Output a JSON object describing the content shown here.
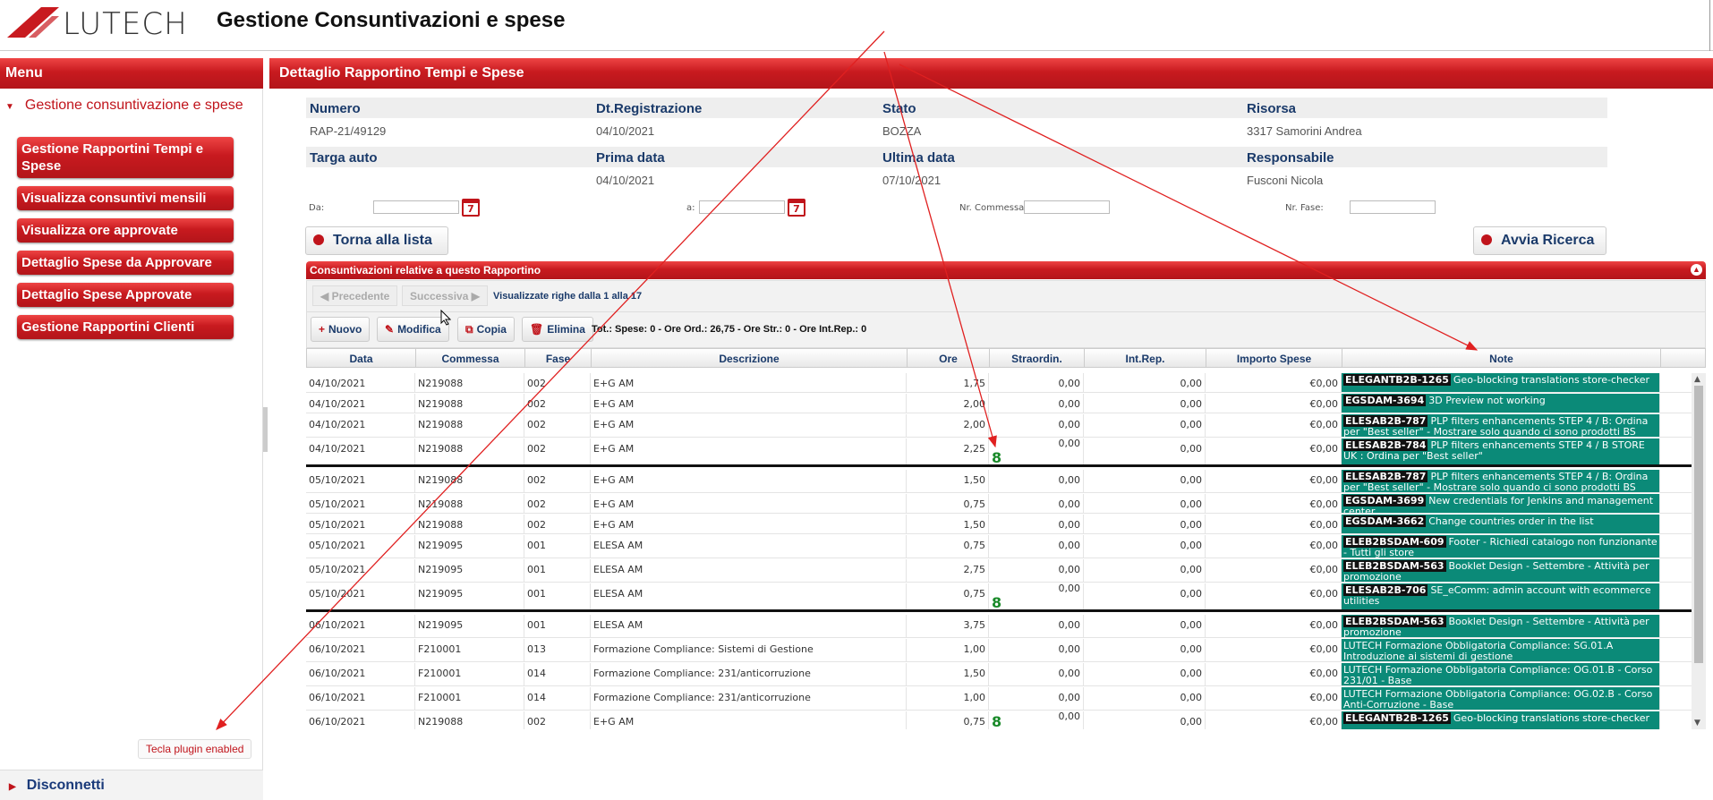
{
  "header": {
    "logo_text": "LUTECH",
    "title": "Gestione Consuntivazioni e spese"
  },
  "menu": {
    "title": "Menu",
    "section": "Gestione consuntivazione e spese",
    "items": [
      {
        "label": "Gestione Rapportini Tempi e Spese"
      },
      {
        "label": "Visualizza consuntivi mensili"
      },
      {
        "label": "Visualizza ore approvate"
      },
      {
        "label": "Dettaglio Spese da Approvare"
      },
      {
        "label": "Dettaglio Spese Approvate"
      },
      {
        "label": "Gestione Rapportini Clienti"
      }
    ],
    "plugin_badge": "Tecla plugin enabled",
    "disconnect": "Disconnetti"
  },
  "main": {
    "title": "Dettaglio Rapportino Tempi e Spese",
    "info": {
      "numero_label": "Numero",
      "numero": "RAP-21/49129",
      "dtreg_label": "Dt.Registrazione",
      "dtreg": "04/10/2021",
      "stato_label": "Stato",
      "stato": "BOZZA",
      "risorsa_label": "Risorsa",
      "risorsa": "3317 Samorini Andrea",
      "targa_label": "Targa auto",
      "targa": "",
      "prima_label": "Prima data",
      "prima": "04/10/2021",
      "ultima_label": "Ultima data",
      "ultima": "07/10/2021",
      "resp_label": "Responsabile",
      "resp": "Fusconi Nicola"
    },
    "filters": {
      "da": "Da:",
      "a": "a:",
      "commessa": "Nr. Commessa:",
      "fase": "Nr. Fase:",
      "calendar_icon": "7"
    },
    "back_button": "Torna alla lista",
    "search_button": "Avvia Ricerca",
    "grid_title": "Consuntivazioni relative a questo Rapportino",
    "pager": {
      "prev": "Precedente",
      "next": "Successiva",
      "info": "Visualizzate righe dalla 1 alla 17"
    },
    "toolbar": {
      "nuovo": "Nuovo",
      "modifica": "Modifica",
      "copia": "Copia",
      "elimina": "Elimina",
      "totals": "Tot.: Spese: 0 - Ore Ord.: 26,75 - Ore Str.: 0 - Ore Int.Rep.: 0"
    },
    "columns": [
      "Data",
      "Commessa",
      "Fase",
      "Descrizione",
      "Ore",
      "Straordin.",
      "Int.Rep.",
      "Importo Spese",
      "Note"
    ],
    "rows": [
      {
        "data": "04/10/2021",
        "commessa": "N219088",
        "fase": "002",
        "desc": "E+G AM",
        "ore": "1,75",
        "str": "0,00",
        "int": "0,00",
        "imp": "€0,00",
        "tag": "ELEGANTB2B-1265",
        "note": "Geo-blocking translations store-checker"
      },
      {
        "data": "04/10/2021",
        "commessa": "N219088",
        "fase": "002",
        "desc": "E+G AM",
        "ore": "2,00",
        "str": "0,00",
        "int": "0,00",
        "imp": "€0,00",
        "tag": "EGSDAM-3694",
        "note": "3D Preview not working"
      },
      {
        "data": "04/10/2021",
        "commessa": "N219088",
        "fase": "002",
        "desc": "E+G AM",
        "ore": "2,00",
        "str": "0,00",
        "int": "0,00",
        "imp": "€0,00",
        "tag": "ELESAB2B-787",
        "note": "PLP filters enhancements STEP 4 / B: Ordina per \"Best seller\" - Mostrare solo quando ci sono prodotti BS"
      },
      {
        "data": "04/10/2021",
        "commessa": "N219088",
        "fase": "002",
        "desc": "E+G AM",
        "ore": "2,25",
        "str": "0,00",
        "int": "0,00",
        "imp": "€0,00",
        "tag": "ELESAB2B-784",
        "note": "PLP filters enhancements STEP 4 / B STORE UK : Ordina per \"Best seller\"",
        "eight": "8"
      },
      {
        "data": "05/10/2021",
        "commessa": "N219088",
        "fase": "002",
        "desc": "E+G AM",
        "ore": "1,50",
        "str": "0,00",
        "int": "0,00",
        "imp": "€0,00",
        "tag": "ELESAB2B-787",
        "note": "PLP filters enhancements STEP 4 / B: Ordina per \"Best seller\" - Mostrare solo quando ci sono prodotti BS"
      },
      {
        "data": "05/10/2021",
        "commessa": "N219088",
        "fase": "002",
        "desc": "E+G AM",
        "ore": "0,75",
        "str": "0,00",
        "int": "0,00",
        "imp": "€0,00",
        "tag": "EGSDAM-3699",
        "note": "New credentials for Jenkins and management center"
      },
      {
        "data": "05/10/2021",
        "commessa": "N219088",
        "fase": "002",
        "desc": "E+G AM",
        "ore": "1,50",
        "str": "0,00",
        "int": "0,00",
        "imp": "€0,00",
        "tag": "EGSDAM-3662",
        "note": "Change countries order in the list"
      },
      {
        "data": "05/10/2021",
        "commessa": "N219095",
        "fase": "001",
        "desc": "ELESA AM",
        "ore": "0,75",
        "str": "0,00",
        "int": "0,00",
        "imp": "€0,00",
        "tag": "ELEB2BSDAM-609",
        "note": "Footer - Richiedi catalogo non funzionante - Tutti gli store"
      },
      {
        "data": "05/10/2021",
        "commessa": "N219095",
        "fase": "001",
        "desc": "ELESA AM",
        "ore": "2,75",
        "str": "0,00",
        "int": "0,00",
        "imp": "€0,00",
        "tag": "ELEB2BSDAM-563",
        "note": "Booklet Design - Settembre - Attività per promozione"
      },
      {
        "data": "05/10/2021",
        "commessa": "N219095",
        "fase": "001",
        "desc": "ELESA AM",
        "ore": "0,75",
        "str": "0,00",
        "int": "0,00",
        "imp": "€0,00",
        "tag": "ELESAB2B-706",
        "note": "SE_eComm: admin account with ecommerce utilities",
        "eight": "8"
      },
      {
        "data": "06/10/2021",
        "commessa": "N219095",
        "fase": "001",
        "desc": "ELESA AM",
        "ore": "3,75",
        "str": "0,00",
        "int": "0,00",
        "imp": "€0,00",
        "tag": "ELEB2BSDAM-563",
        "note": "Booklet Design - Settembre - Attività per promozione"
      },
      {
        "data": "06/10/2021",
        "commessa": "F210001",
        "fase": "013",
        "desc": "Formazione Compliance: Sistemi di Gestione",
        "ore": "1,00",
        "str": "0,00",
        "int": "0,00",
        "imp": "€0,00",
        "tag": "",
        "note": "LUTECH Formazione Obbligatoria Compliance: SG.01.A Introduzione ai sistemi di gestione"
      },
      {
        "data": "06/10/2021",
        "commessa": "F210001",
        "fase": "014",
        "desc": "Formazione Compliance: 231/anticorruzione",
        "ore": "1,50",
        "str": "0,00",
        "int": "0,00",
        "imp": "€0,00",
        "tag": "",
        "note": "LUTECH Formazione Obbligatoria Compliance: OG.01.B - Corso 231/01 - Base"
      },
      {
        "data": "06/10/2021",
        "commessa": "F210001",
        "fase": "014",
        "desc": "Formazione Compliance: 231/anticorruzione",
        "ore": "1,00",
        "str": "0,00",
        "int": "0,00",
        "imp": "€0,00",
        "tag": "",
        "note": "LUTECH Formazione Obbligatoria Compliance: OG.02.B - Corso Anti-Corruzione - Base"
      },
      {
        "data": "06/10/2021",
        "commessa": "N219088",
        "fase": "002",
        "desc": "E+G AM",
        "ore": "0,75",
        "str": "0,00",
        "int": "0,00",
        "imp": "€0,00",
        "tag": "ELEGANTB2B-1265",
        "note": "Geo-blocking translations store-checker",
        "eight": "8"
      }
    ]
  },
  "colors": {
    "brand_red": "#c81a1f",
    "note_teal": "#0b8a78",
    "annotation_arrow": "#e02020"
  }
}
